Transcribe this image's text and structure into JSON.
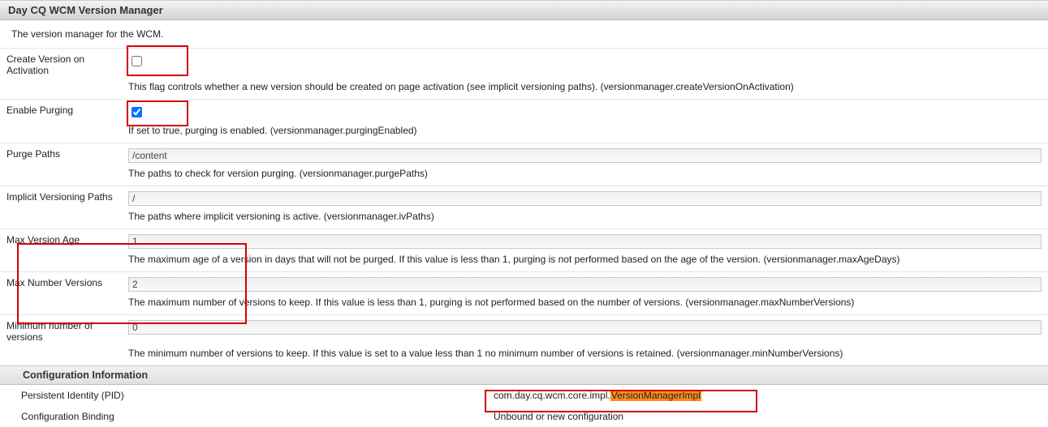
{
  "header": {
    "title": "Day CQ WCM Version Manager"
  },
  "description": "The version manager for the WCM.",
  "props": {
    "createVersion": {
      "label": "Create Version on Activation",
      "checked": false,
      "hint": "This flag controls whether a new version should be created on page activation (see implicit versioning paths). (versionmanager.createVersionOnActivation)"
    },
    "enablePurging": {
      "label": "Enable Purging",
      "checked": true,
      "hint": "If set to true, purging is enabled. (versionmanager.purgingEnabled)"
    },
    "purgePaths": {
      "label": "Purge Paths",
      "value": "/content",
      "hint": "The paths to check for version purging. (versionmanager.purgePaths)"
    },
    "ivPaths": {
      "label": "Implicit Versioning Paths",
      "value": "/",
      "hint": "The paths where implicit versioning is active. (versionmanager.ivPaths)"
    },
    "maxAge": {
      "label": "Max Version Age",
      "value": "1",
      "hint": "The maximum age of a version in days that will not be purged. If this value is less than 1, purging is not performed based on the age of the version. (versionmanager.maxAgeDays)"
    },
    "maxNum": {
      "label": "Max Number Versions",
      "value": "2",
      "hint": "The maximum number of versions to keep. If this value is less than 1, purging is not performed based on the number of versions. (versionmanager.maxNumberVersions)"
    },
    "minNum": {
      "label": "Minimum number of versions",
      "value": "0",
      "hint": "The minimum number of versions to keep. If this value is set to a value less than 1 no minimum number of versions is retained. (versionmanager.minNumberVersions)"
    }
  },
  "configInfo": {
    "header": "Configuration Information",
    "pid": {
      "label": "Persistent Identity (PID)",
      "prefix": "com.day.cq.wcm.core.impl.",
      "highlight": "VersionManagerImpl"
    },
    "binding": {
      "label": "Configuration Binding",
      "value": "Unbound or new configuration"
    }
  }
}
